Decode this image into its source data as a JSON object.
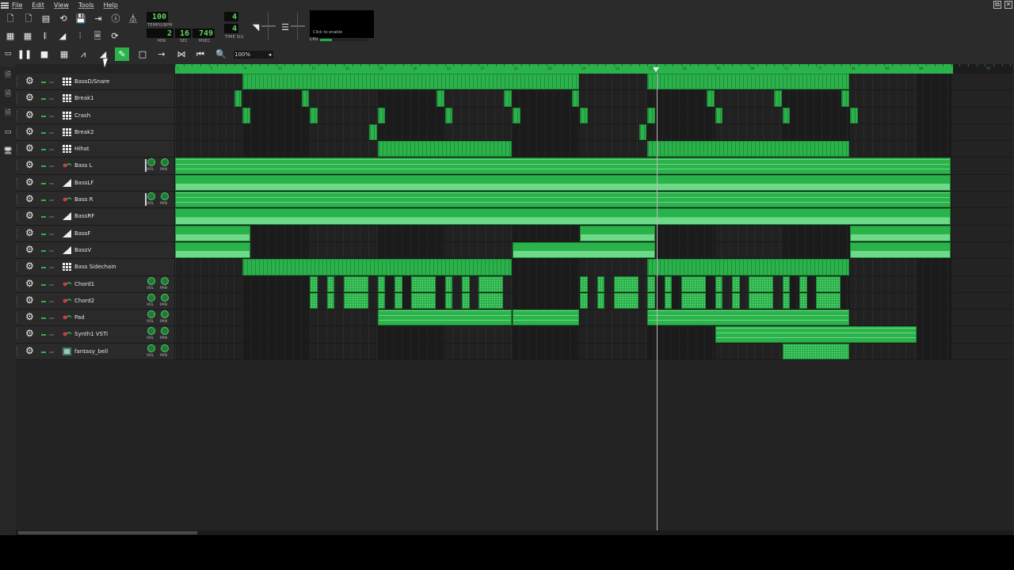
{
  "menu": {
    "items": [
      "File",
      "Edit",
      "View",
      "Tools",
      "Help"
    ]
  },
  "transport": {
    "tempo": "100",
    "tempo_label": "TEMPO/BPM",
    "min": "2",
    "sec": "16",
    "msec": "749",
    "min_label": "MIN",
    "sec_label": "SEC",
    "msec_label": "MSEC",
    "timesig_num": "4",
    "timesig_den": "4",
    "timesig_label": "TIME SIG"
  },
  "cpu": {
    "message": "Click to enable",
    "label": "CPU"
  },
  "editor_toolbar": {
    "zoom": "100%"
  },
  "ruler": {
    "bars": [
      "1",
      "5",
      "9",
      "13",
      "17",
      "21",
      "25",
      "29",
      "33",
      "37",
      "41",
      "45",
      "49",
      "53",
      "57",
      "61",
      "65",
      "69",
      "73",
      "77",
      "81",
      "85",
      "89",
      "93",
      "97"
    ]
  },
  "track_labels": {
    "vol": "VOL",
    "pan": "PAN"
  },
  "tracks": [
    {
      "name": "BassD/Snare",
      "type": "beat"
    },
    {
      "name": "Break1",
      "type": "beat"
    },
    {
      "name": "Crash",
      "type": "beat"
    },
    {
      "name": "Break2",
      "type": "beat"
    },
    {
      "name": "Hihat",
      "type": "beat"
    },
    {
      "name": "Bass L",
      "type": "instrument"
    },
    {
      "name": "BassLF",
      "type": "automation"
    },
    {
      "name": "Bass R",
      "type": "instrument"
    },
    {
      "name": "BassRF",
      "type": "automation"
    },
    {
      "name": "BassF",
      "type": "automation"
    },
    {
      "name": "BassV",
      "type": "automation"
    },
    {
      "name": "Bass Sidechain",
      "type": "beat"
    },
    {
      "name": "Chord1",
      "type": "instrument"
    },
    {
      "name": "Chord2",
      "type": "instrument"
    },
    {
      "name": "Pad",
      "type": "instrument"
    },
    {
      "name": "Synth1 VSTi",
      "type": "instrument"
    },
    {
      "name": "fantasy_bell",
      "type": "sample"
    }
  ],
  "colors": {
    "accent": "#2bb34b",
    "background": "#2b2b2b",
    "lane": "#212121"
  }
}
